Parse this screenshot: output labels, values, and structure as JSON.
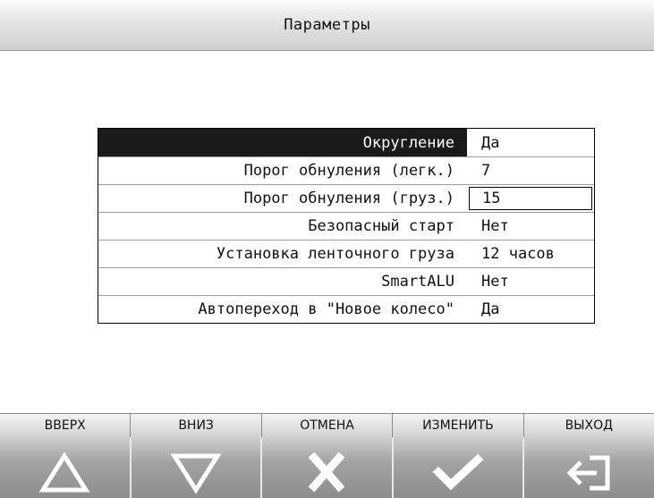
{
  "header": {
    "title": "Параметры"
  },
  "params": [
    {
      "label": "Округление",
      "value": "Да"
    },
    {
      "label": "Порог обнуления (легк.)",
      "value": "7"
    },
    {
      "label": "Порог обнуления (груз.)",
      "value": "15"
    },
    {
      "label": "Безопасный старт",
      "value": "Нет"
    },
    {
      "label": "Установка ленточного груза",
      "value": "12 часов"
    },
    {
      "label": "SmartALU",
      "value": "Нет"
    },
    {
      "label": "Автопереход в \"Новое колесо\"",
      "value": "Да"
    }
  ],
  "toolbar": {
    "buttons": [
      {
        "label": "ВВЕРХ",
        "icon": "triangle-up-icon"
      },
      {
        "label": "ВНИЗ",
        "icon": "triangle-down-icon"
      },
      {
        "label": "ОТМЕНА",
        "icon": "cross-icon"
      },
      {
        "label": "ИЗМЕНИТЬ",
        "icon": "checkmark-icon"
      },
      {
        "label": "ВЫХОД",
        "icon": "exit-icon"
      }
    ]
  },
  "colors": {
    "selected_row": "#1a1a1a",
    "selected_text": "#ffffff",
    "icon_fill": "#ffffff"
  }
}
